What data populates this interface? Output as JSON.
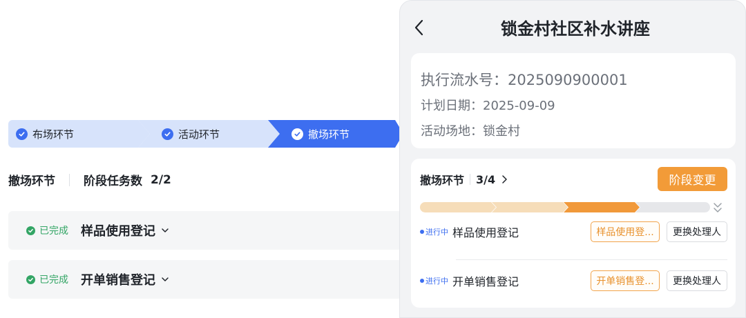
{
  "left": {
    "steps": [
      {
        "label": "布场环节",
        "state": "done"
      },
      {
        "label": "活动环节",
        "state": "done"
      },
      {
        "label": "撤场环节",
        "state": "current"
      }
    ],
    "phase": {
      "name": "撤场环节",
      "count_label": "阶段任务数",
      "count": "2/2"
    },
    "tasks": [
      {
        "status": "已完成",
        "name": "样品使用登记"
      },
      {
        "status": "已完成",
        "name": "开单销售登记"
      }
    ]
  },
  "phone": {
    "title": "锁金村社区补水讲座",
    "info": {
      "serial": "执行流水号：2025090900001",
      "date": "计划日期：2025-09-09",
      "venue": "活动场地：锁金村"
    },
    "stage": {
      "name": "撤场环节",
      "progress": "3/4",
      "change_button": "阶段变更",
      "progress_segments": 4,
      "current_segment": 3
    },
    "rows": [
      {
        "tag": "进行中",
        "name": "样品使用登记",
        "action": "样品使用登...",
        "reassign": "更换处理人"
      },
      {
        "tag": "进行中",
        "name": "开单销售登记",
        "action": "开单销售登...",
        "reassign": "更换处理人"
      }
    ]
  },
  "colors": {
    "primary": "#3d6ef0",
    "step_inactive": "#d7e3fb",
    "success": "#33a565",
    "orange": "#f29b38",
    "progress_done": "#f6ddb9",
    "progress_todo": "#e6e7ea"
  }
}
